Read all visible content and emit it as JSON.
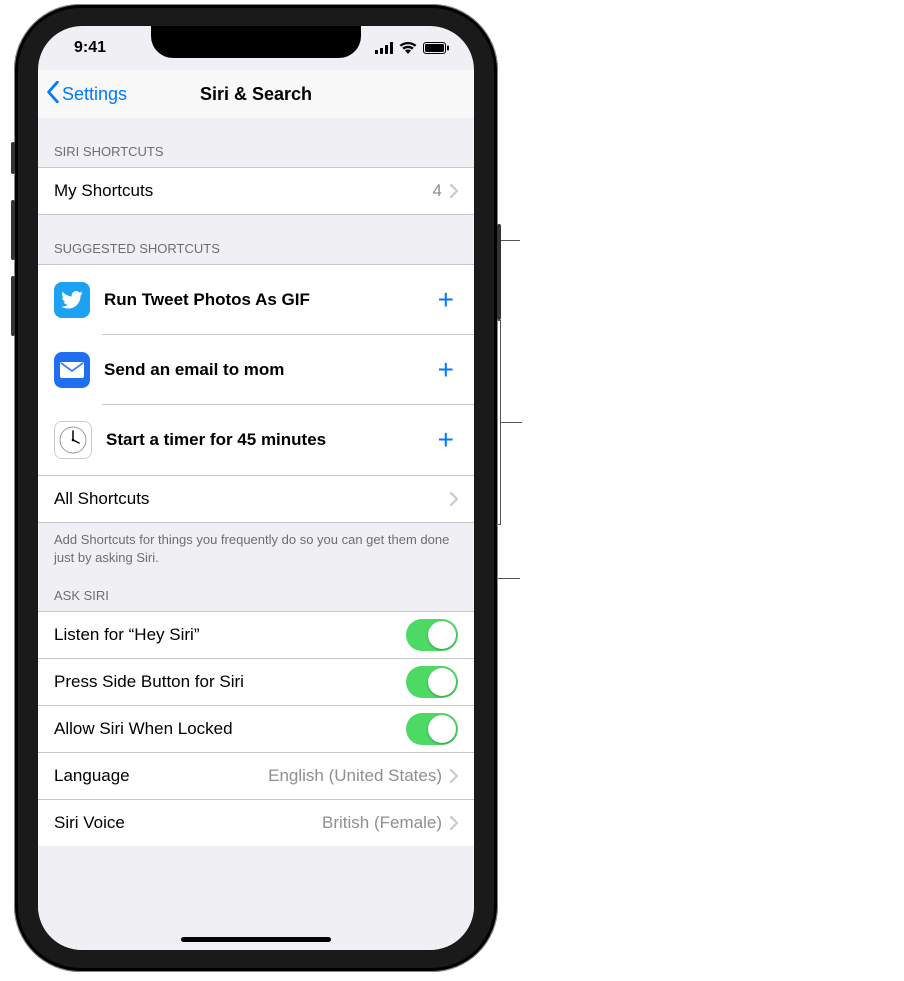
{
  "statusbar": {
    "time": "9:41"
  },
  "nav": {
    "back": "Settings",
    "title": "Siri & Search"
  },
  "sections": {
    "siri_shortcuts": {
      "header": "SIRI SHORTCUTS",
      "my_shortcuts": {
        "label": "My Shortcuts",
        "count": "4"
      }
    },
    "suggested": {
      "header": "SUGGESTED SHORTCUTS",
      "items": [
        {
          "label": "Run Tweet Photos As GIF"
        },
        {
          "label": "Send an email to mom"
        },
        {
          "label": "Start a timer for 45 minutes"
        }
      ],
      "all_shortcuts": {
        "label": "All Shortcuts"
      },
      "footer": "Add Shortcuts for things you frequently do so you can get them done just by asking Siri."
    },
    "ask_siri": {
      "header": "ASK SIRI",
      "hey_siri": {
        "label": "Listen for “Hey Siri”"
      },
      "side_button": {
        "label": "Press Side Button for Siri"
      },
      "allow_locked": {
        "label": "Allow Siri When Locked"
      },
      "language": {
        "label": "Language",
        "value": "English (United States)"
      },
      "voice": {
        "label": "Siri Voice",
        "value": "British (Female)"
      }
    }
  }
}
